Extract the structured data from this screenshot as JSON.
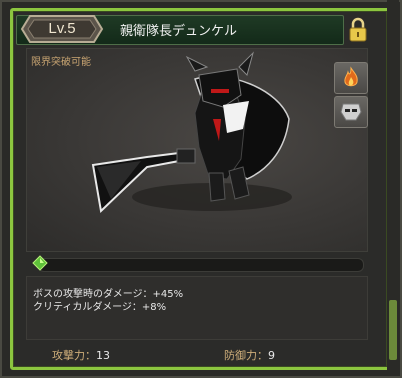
{
  "header": {
    "level": "Lv.5",
    "name": "親衛隊長デュンケル"
  },
  "viewport": {
    "limit_break_text": "限界突破可能"
  },
  "side_buttons": [
    "flame-icon",
    "mask-icon"
  ],
  "progress": {
    "fraction": 0.0
  },
  "stats": {
    "line1": "ボスの攻撃時のダメージ：+45%",
    "line2": "クリティカルダメージ：+8%"
  },
  "footer": {
    "attack_label": "攻撃力：",
    "attack_value": "13",
    "defense_label": "防御力：",
    "defense_value": "9"
  },
  "colors": {
    "accent": "#8cc63f",
    "gold": "#cfae7a"
  }
}
